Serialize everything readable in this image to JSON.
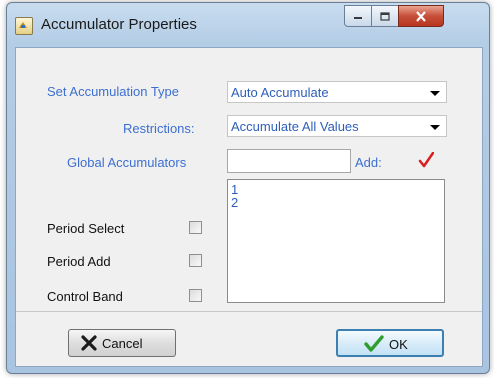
{
  "window": {
    "title": "Accumulator Properties",
    "icon": "app-icon",
    "controls": [
      "minimize-icon",
      "maximize-icon",
      "close-icon"
    ]
  },
  "form": {
    "accumulation_type_label": "Set Accumulation Type",
    "accumulation_type_value": "Auto Accumulate",
    "restrictions_label": "Restrictions:",
    "restrictions_value": "Accumulate All Values",
    "global_label": "Global Accumulators",
    "global_value": "",
    "add_label": "Add:",
    "add_icon": "checkmark-icon",
    "accumulators_list": [
      "1",
      "2"
    ],
    "period_select_label": "Period Select",
    "period_select_checked": false,
    "period_add_label": "Period Add",
    "period_add_checked": false,
    "control_band_label": "Control Band",
    "control_band_checked": false
  },
  "buttons": {
    "cancel_label": "Cancel",
    "cancel_icon": "x-icon",
    "ok_label": "OK",
    "ok_icon": "checkmark-icon"
  },
  "colors": {
    "label_blue": "#3d6fd1",
    "value_blue": "#2d5fb8",
    "add_check_red": "#d81e1e",
    "ok_check_green": "#2f9d2f",
    "cancel_x": "#1a1a1a",
    "close_button": "#c7503a"
  }
}
